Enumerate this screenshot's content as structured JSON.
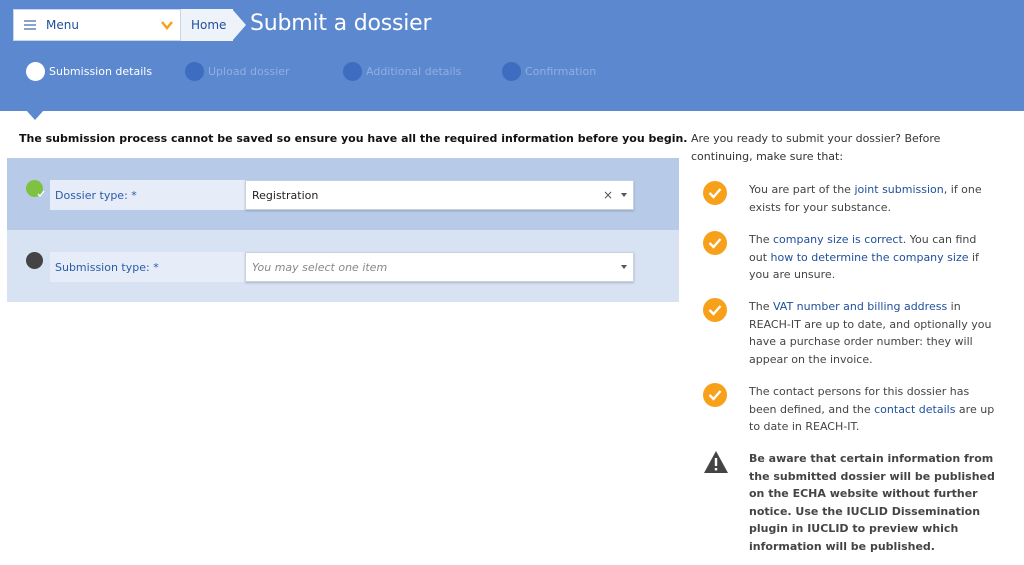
{
  "header": {
    "menu_label": "Menu",
    "breadcrumb_home": "Home",
    "title": "Submit a dossier"
  },
  "steps": [
    {
      "label": "Submission details",
      "active": true
    },
    {
      "label": "Upload dossier",
      "active": false
    },
    {
      "label": "Additional details",
      "active": false
    },
    {
      "label": "Confirmation",
      "active": false
    }
  ],
  "main": {
    "intro": "The submission process cannot be saved so ensure you have all the required information before you begin.",
    "dossier_type": {
      "label": "Dossier type: *",
      "value": "Registration"
    },
    "submission_type": {
      "label": "Submission type: *",
      "placeholder": "You may select one item"
    }
  },
  "sidebar": {
    "intro": "Are you ready to submit your dossier? Before continuing, make sure that:",
    "item1": {
      "pre": "You are part of the ",
      "link": "joint submission",
      "post": ", if one exists for your substance."
    },
    "item2": {
      "pre": "The ",
      "link1": "company size is correct",
      "mid": ". You can find out ",
      "link2": "how to determine the company size",
      "post": " if you are unsure."
    },
    "item3": {
      "pre": "The ",
      "link": "VAT number and billing address",
      "post": " in REACH-IT are up to date, and optionally you have a purchase order number: they will appear on the invoice."
    },
    "item4": {
      "pre": "The contact persons for this dossier has been defined, and the ",
      "link": "contact details",
      "post": " are up to date in REACH-IT."
    },
    "warning": "Be aware that certain information from the submitted dossier will be published on the ECHA website without further notice. Use the IUCLID Dissemination plugin in IUCLID to preview which information will be published."
  },
  "colors": {
    "header_bg": "#5b88cf",
    "accent_orange": "#f7a11a",
    "link_blue": "#1f4f9b",
    "done_green": "#7fc241"
  }
}
